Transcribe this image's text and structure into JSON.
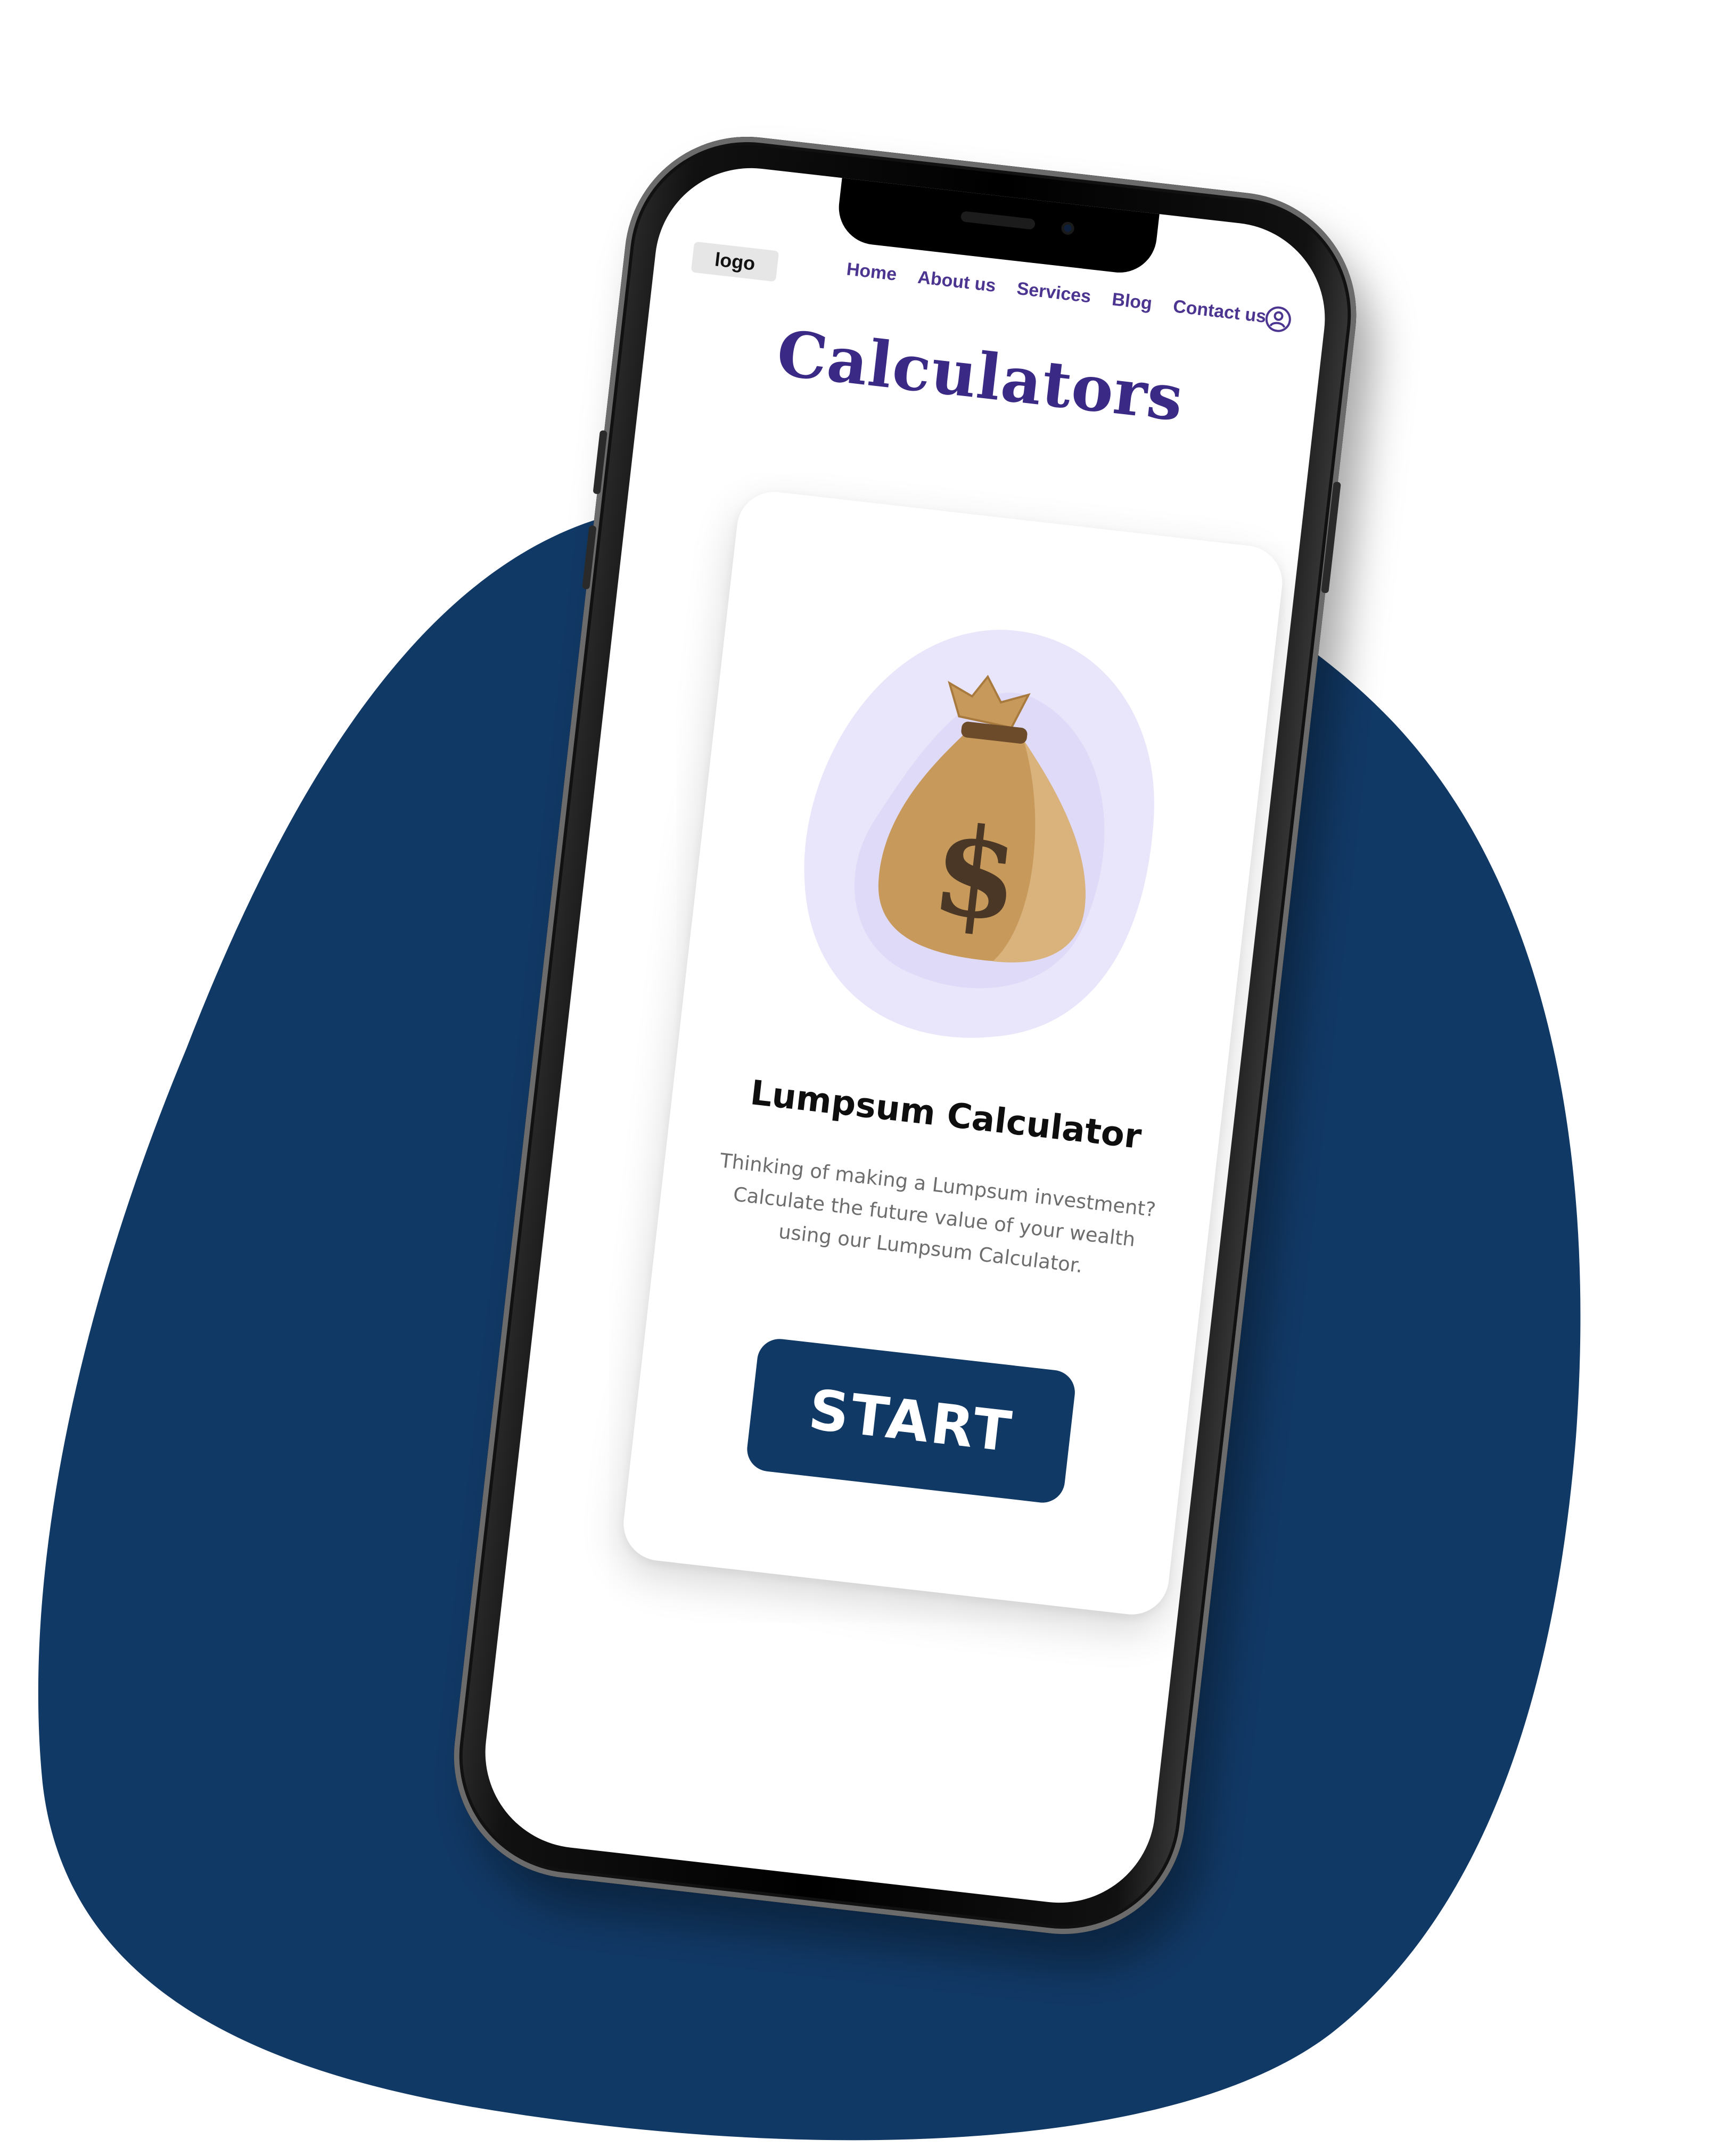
{
  "header": {
    "logo_text": "logo",
    "nav_items": [
      "Home",
      "About us",
      "Services",
      "Blog",
      "Contact us"
    ],
    "user_icon": "user-circle-icon"
  },
  "page": {
    "title": "Calculators"
  },
  "card": {
    "illustration_icon": "money-bag-icon",
    "illustration_glyph": "$",
    "title": "Lumpsum Calculator",
    "description": "Thinking of making a Lumpsum investment? Calculate the future value of your wealth using our Lumpsum Calculator.",
    "button_label": "START"
  },
  "colors": {
    "background_blob": "#113966",
    "nav_text": "#4c3590",
    "title_text": "#3b2a85",
    "button_bg": "#113966",
    "illustration_bg": "#e9e6fb",
    "bag_fill": "#c79a5b"
  }
}
